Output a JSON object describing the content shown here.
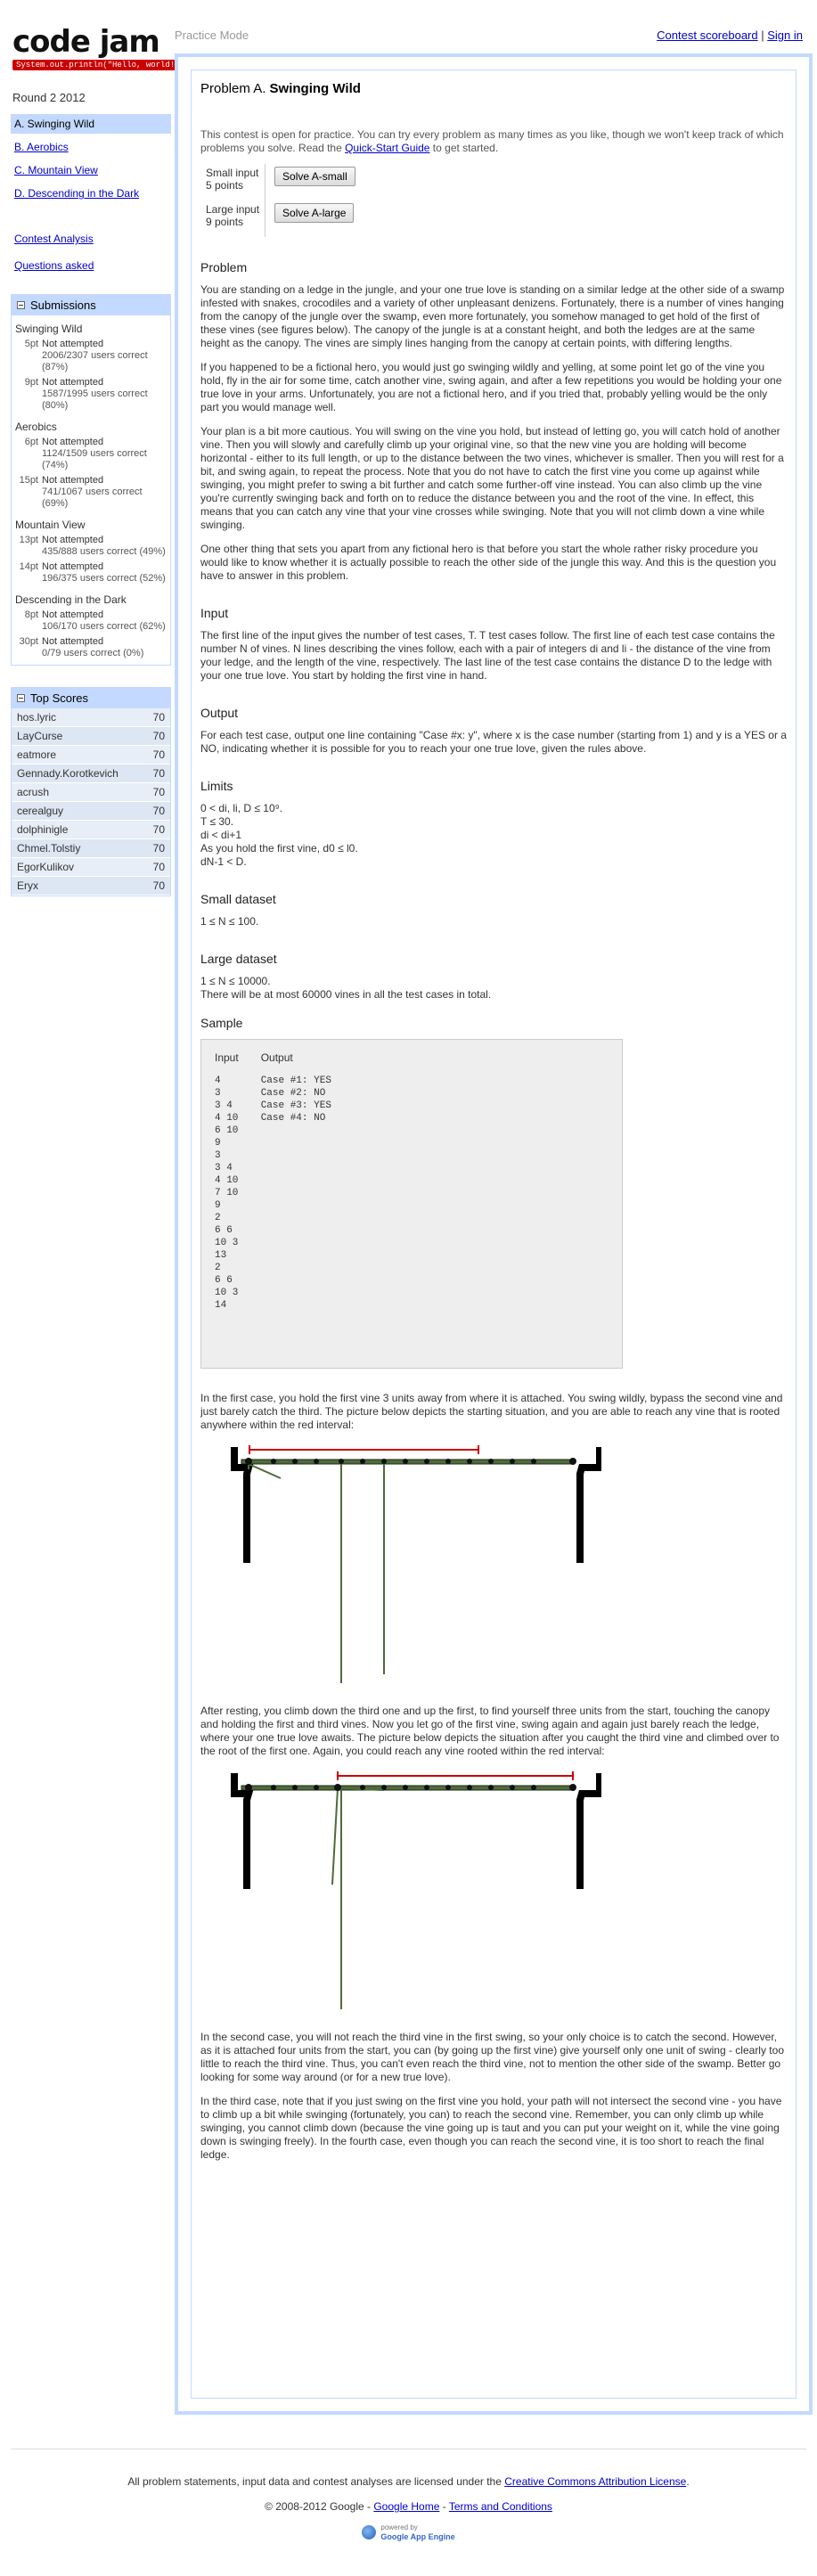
{
  "header": {
    "logo_title": "code jam",
    "logo_tagline": "System.out.println(\"Hello, world!\");",
    "mode": "Practice Mode",
    "scoreboard_link": "Contest scoreboard",
    "signin_link": "Sign in",
    "separator": "|"
  },
  "round_name": "Round 2 2012",
  "sidebar": {
    "problems": [
      {
        "label": "A. Swinging Wild"
      },
      {
        "label": "B. Aerobics"
      },
      {
        "label": "C. Mountain View"
      },
      {
        "label": "D. Descending in the Dark"
      }
    ],
    "contest_analysis": "Contest Analysis",
    "questions_asked": "Questions asked",
    "submissions_title": "Submissions",
    "submissions": [
      {
        "problem": "Swinging Wild",
        "rows": [
          {
            "pts": "5pt",
            "status": "Not attempted",
            "users": "2006/2307",
            "pct": "correct (87%)"
          },
          {
            "pts": "9pt",
            "status": "Not attempted",
            "users": "1587/1995",
            "pct": "correct (80%)"
          }
        ]
      },
      {
        "problem": "Aerobics",
        "rows": [
          {
            "pts": "6pt",
            "status": "Not attempted",
            "users": "1124/1509",
            "pct": "correct (74%)"
          },
          {
            "pts": "15pt",
            "status": "Not attempted",
            "users": "741/1067",
            "pct": "correct (69%)"
          }
        ]
      },
      {
        "problem": "Mountain View",
        "rows": [
          {
            "pts": "13pt",
            "status": "Not attempted",
            "users": "435/888",
            "pct": "correct (49%)"
          },
          {
            "pts": "14pt",
            "status": "Not attempted",
            "users": "196/375",
            "pct": "correct (52%)"
          }
        ]
      },
      {
        "problem": "Descending in the Dark",
        "rows": [
          {
            "pts": "8pt",
            "status": "Not attempted",
            "users": "106/170",
            "pct": "correct (62%)"
          },
          {
            "pts": "30pt",
            "status": "Not attempted",
            "users": "0/79",
            "pct": "correct (0%)"
          }
        ]
      }
    ],
    "users_word": "users",
    "top_scores_title": "Top Scores",
    "top_scores": [
      {
        "name": "hos.lyric",
        "score": "70"
      },
      {
        "name": "LayCurse",
        "score": "70"
      },
      {
        "name": "eatmore",
        "score": "70"
      },
      {
        "name": "Gennady.Korotkevich",
        "score": "70"
      },
      {
        "name": "acrush",
        "score": "70"
      },
      {
        "name": "cerealguy",
        "score": "70"
      },
      {
        "name": "dolphinigle",
        "score": "70"
      },
      {
        "name": "Chmel.Tolstiy",
        "score": "70"
      },
      {
        "name": "EgorKulikov",
        "score": "70"
      },
      {
        "name": "Eryx",
        "score": "70"
      }
    ]
  },
  "problem": {
    "title_prefix": "Problem A.",
    "title": "Swinging Wild",
    "practice_note": "This contest is open for practice. You can try every problem as many times as you like, though we won't keep track of which problems you solve. Read the ",
    "guide_link": "Quick-Start Guide",
    "practice_note_end": " to get started.",
    "small_input": "Small input",
    "small_points": "5 points",
    "small_button": "Solve A-small",
    "large_input": "Large input",
    "large_points": "9 points",
    "large_button": "Solve A-large",
    "h_problem": "Problem",
    "p1": "You are standing on a ledge in the jungle, and your one true love is standing on a similar ledge at the other side of a swamp infested with snakes, crocodiles and a variety of other unpleasant denizens. Fortunately, there is a number of vines hanging from the canopy of the jungle over the swamp, even more fortunately, you somehow managed to get hold of the first of these vines (see figures below). The canopy of the jungle is at a constant height, and both the ledges are at the same height as the canopy. The vines are simply lines hanging from the canopy at certain points, with differing lengths.",
    "p2": "If you happened to be a fictional hero, you would just go swinging wildly and yelling, at some point let go of the vine you hold, fly in the air for some time, catch another vine, swing again, and after a few repetitions you would be holding your one true love in your arms. Unfortunately, you are not a fictional hero, and if you tried that, probably yelling would be the only part you would manage well.",
    "p3": "Your plan is a bit more cautious. You will swing on the vine you hold, but instead of letting go, you will catch hold of another vine. Then you will slowly and carefully climb up your original vine, so that the new vine you are holding will become horizontal - either to its full length, or up to the distance between the two vines, whichever is smaller. Then you will rest for a bit, and swing again, to repeat the process. Note that you do not have to catch the first vine you come up against while swinging, you might prefer to swing a bit further and catch some further-off vine instead. You can also climb up the vine you're currently swinging back and forth on to reduce the distance between you and the root of the vine. In effect, this means that you can catch any vine that your vine crosses while swinging. Note that you will not climb down a vine while swinging.",
    "p4": "One other thing that sets you apart from any fictional hero is that before you start the whole rather risky procedure you would like to know whether it is actually possible to reach the other side of the jungle this way. And this is the question you have to answer in this problem.",
    "h_input": "Input",
    "input_text": "The first line of the input gives the number of test cases, T. T test cases follow. The first line of each test case contains the number N of vines. N lines describing the vines follow, each with a pair of integers di and li - the distance of the vine from your ledge, and the length of the vine, respectively. The last line of the test case contains the distance D to the ledge with your one true love. You start by holding the first vine in hand.",
    "h_output": "Output",
    "output_text": "For each test case, output one line containing \"Case #x: y\", where x is the case number (starting from 1) and y is a YES or a NO, indicating whether it is possible for you to reach your one true love, given the rules above.",
    "h_limits": "Limits",
    "limits": [
      "0 < di, li, D ≤ 10⁹.",
      "T ≤ 30.",
      "di < di+1",
      "As you hold the first vine, d0 ≤ l0.",
      "dN-1 < D."
    ],
    "h_small": "Small dataset",
    "small_limit": "1 ≤ N ≤ 100.",
    "h_large": "Large dataset",
    "large_limit": "1 ≤ N ≤ 10000.",
    "large_note": "There will be at most 60000 vines in all the test cases in total.",
    "h_sample": "Sample",
    "sample_input_head": "Input",
    "sample_output_head": "Output",
    "sample_input": "4\n3\n3 4\n4 10\n6 10\n9\n3\n3 4\n4 10\n7 10\n9\n2\n6 6\n10 3\n13\n2\n6 6\n10 3\n14",
    "sample_output": "Case #1: YES\nCase #2: NO\nCase #3: YES\nCase #4: NO",
    "case1": "In the first case, you hold the first vine 3 units away from where it is attached. You swing wildly, bypass the second vine and just barely catch the third. The picture below depicts the starting situation, and you are able to reach any vine that is rooted anywhere within the red interval:",
    "case2": "After resting, you climb down the third one and up the first, to find yourself three units from the start, touching the canopy and holding the first and third vines. Now you let go of the first vine, swing again and again just barely reach the ledge, where your one true love awaits. The picture below depicts the situation after you caught the third vine and climbed over to the root of the first one. Again, you could reach any vine rooted within the red interval:",
    "case3": "In the second case, you will not reach the third vine in the first swing, so your only choice is to catch the second. However, as it is attached four units from the start, you can (by going up the first vine) give yourself only one unit of swing - clearly too little to reach the third vine. Thus, you can't even reach the third vine, not to mention the other side of the swamp. Better go looking for some way around (or for a new true love).",
    "case4": "In the third case, note that if you just swing on the first vine you hold, your path will not intersect the second vine - you have to climb up a bit while swinging (fortunately, you can) to reach the second vine. Remember, you can only climb up while swinging, you cannot climb down (because the vine going up is taut and you can put your weight on it, while the vine going down is swinging freely). In the fourth case, even though you can reach the second vine, it is too short to reach the final ledge."
  },
  "footer": {
    "license_text": "All problem statements, input data and contest analyses are licensed under the ",
    "license_link": "Creative Commons Attribution License",
    "license_end": ".",
    "copyright": "© 2008-2012 Google",
    "google_home": "Google Home",
    "terms": "Terms and Conditions",
    "separator": "-",
    "powered_by": "powered by",
    "app_engine": "Google App Engine"
  },
  "colors": {
    "accent_blue": "#c3d9ff",
    "link": "#0000cc",
    "interval_red": "#cc0000",
    "vine_green": "#4e6b3a",
    "tagline_red": "#cc0000"
  }
}
